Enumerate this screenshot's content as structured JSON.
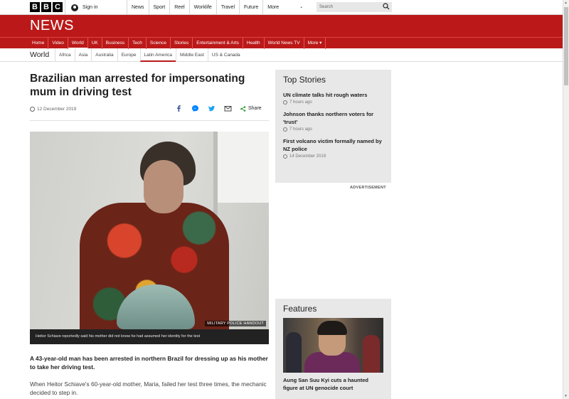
{
  "masthead": {
    "logo_letters": [
      "B",
      "B",
      "C"
    ],
    "signin_label": "Sign in",
    "nav": [
      "News",
      "Sport",
      "Reel",
      "Worklife",
      "Travel",
      "Future"
    ],
    "more_label": "More",
    "search_placeholder": "Search"
  },
  "news_banner": {
    "title": "NEWS",
    "nav": [
      "Home",
      "Video",
      "World",
      "UK",
      "Business",
      "Tech",
      "Science",
      "Stories",
      "Entertainment & Arts",
      "Health",
      "World News TV",
      "More ▾"
    ],
    "active": "World"
  },
  "subnav": {
    "title": "World",
    "items": [
      "Africa",
      "Asia",
      "Australia",
      "Europe",
      "Latin America",
      "Middle East",
      "US & Canada"
    ],
    "active": "Latin America"
  },
  "article": {
    "headline": "Brazilian man arrested for impersonating mum in driving test",
    "date": "12 December 2019",
    "share_label": "Share",
    "photo_credit": "MILITARY POLICE HANDOUT",
    "caption": "Heitor Schiave reportedly said his mother did not know he had assumed her identity for the test",
    "intro": "A 43-year-old man has been arrested in northern Brazil for dressing up as his mother to take her driving test.",
    "body": "When Heitor Schiave's 60-year-old mother, Maria, failed her test three times, the mechanic decided to step in."
  },
  "top_stories": {
    "heading": "Top Stories",
    "items": [
      {
        "title": "UN climate talks hit rough waters",
        "time": "7 hours ago"
      },
      {
        "title": "Johnson thanks northern voters for 'trust'",
        "time": "7 hours ago"
      },
      {
        "title": "First volcano victim formally named by NZ police",
        "time": "14 December 2019"
      }
    ]
  },
  "advertisement_label": "ADVERTISEMENT",
  "features": {
    "heading": "Features",
    "items": [
      {
        "title": "Aung San Suu Kyi cuts a haunted figure at UN genocide court"
      }
    ]
  },
  "colors": {
    "brand_red": "#bb1919",
    "panel_grey": "#e8e8e8"
  }
}
